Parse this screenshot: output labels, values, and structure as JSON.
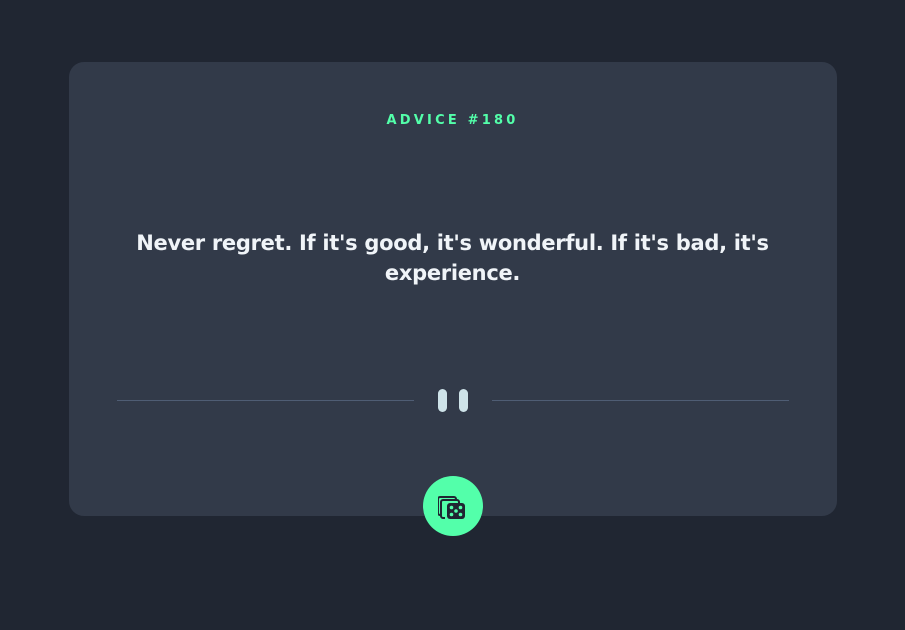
{
  "advice": {
    "id_label": "ADVICE #180",
    "quote": "Never regret. If it's good, it's wonderful. If it's bad, it's experience."
  },
  "icons": {
    "divider": "pause-icon",
    "button": "dice-icon"
  },
  "colors": {
    "background": "#202632",
    "card": "#323a49",
    "accent": "#53ffaa",
    "quote_text": "#f0f4f8",
    "divider_line": "#4f5d74",
    "pause_bars": "#cee3e9"
  }
}
